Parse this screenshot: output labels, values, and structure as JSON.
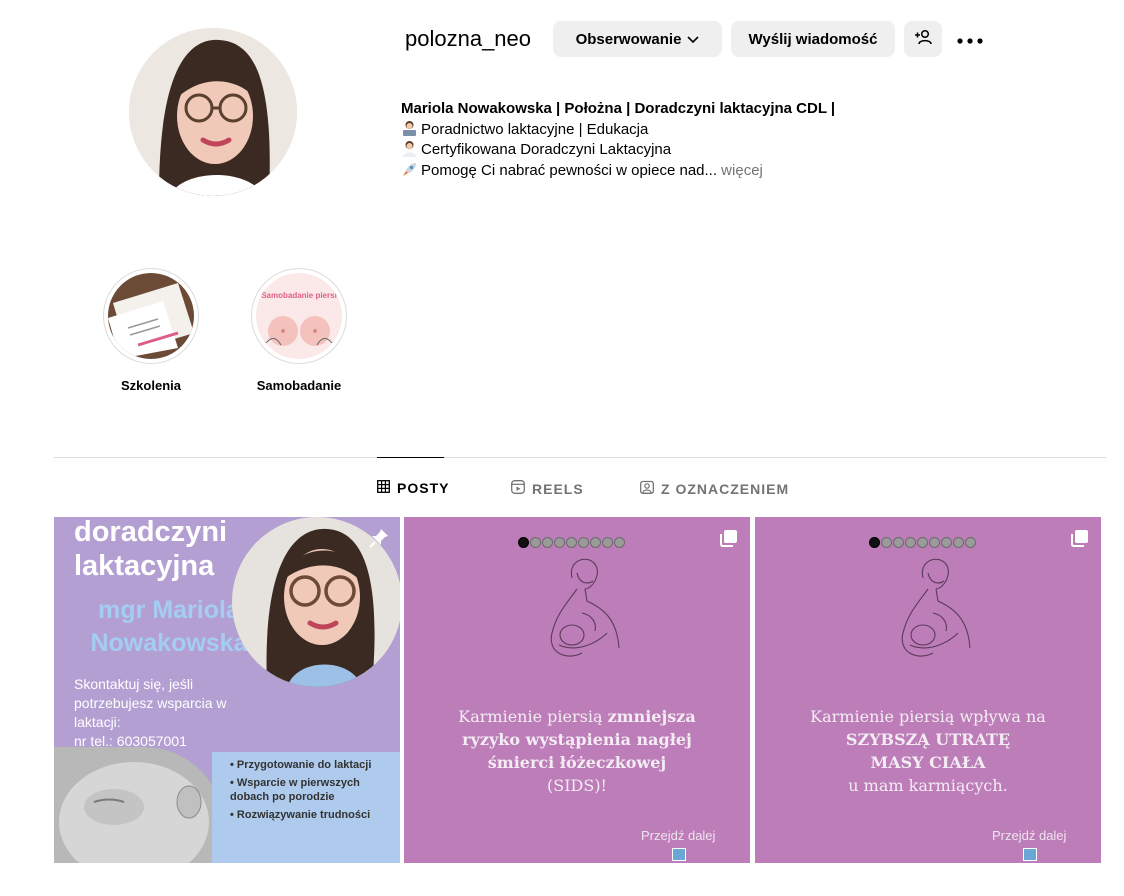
{
  "profile": {
    "username": "polozna_neo",
    "follow_label": "Obserwowanie",
    "message_label": "Wyślij wiadomość",
    "bio": {
      "name_line": "Mariola Nowakowska | Położna | Doradczyni laktacyjna CDL |",
      "line1": "Poradnictwo laktacyjne | Edukacja",
      "line2": "Certyfikowana Doradczyni Laktacyjna",
      "line3": "Pomogę Ci nabrać pewności w opiece nad...",
      "more": " więcej"
    }
  },
  "highlights": [
    {
      "label": "Szkolenia"
    },
    {
      "label": "Samobadanie",
      "cover_text": "Samobadanie piersi"
    }
  ],
  "tabs": [
    {
      "label": "POSTY",
      "icon": "grid-icon",
      "active": true
    },
    {
      "label": "REELS",
      "icon": "reels-icon",
      "active": false
    },
    {
      "label": "Z OZNACZENIEM",
      "icon": "tagged-icon",
      "active": false
    }
  ],
  "posts": [
    {
      "title_l1": "doradczyni",
      "title_l2": "laktacyjna",
      "name_l1": "mgr Mariola",
      "name_l2": "Nowakowska",
      "contact": "Skontaktuj się, jeśli potrzebujesz wsparcia w laktacji:",
      "phone": "nr tel.: 603057001",
      "bullets": [
        "• Przygotowanie do laktacji",
        "• Wsparcie w pierwszych dobach po porodzie",
        "• Rozwiązywanie trudności"
      ],
      "pinned": true
    },
    {
      "line1a": "Karmienie piersią ",
      "line1b": "zmniejsza",
      "line2": "ryzyko wystąpienia nagłej",
      "line3": "śmierci łóżeczkowej",
      "line4": "(SIDS)!",
      "next": "Przejdź dalej"
    },
    {
      "line1": "Karmienie piersią wpływa na",
      "line2": "SZYBSZĄ UTRATĘ",
      "line3": "MASY CIAŁA",
      "line4": "u mam karmiących.",
      "next": "Przejdź dalej"
    }
  ],
  "colors": {
    "post_bg": "#bd7db8",
    "post1_bg": "#b49fd2",
    "post1_name": "#a4cdf2",
    "button_bg": "#efefef",
    "muted": "#737373"
  }
}
